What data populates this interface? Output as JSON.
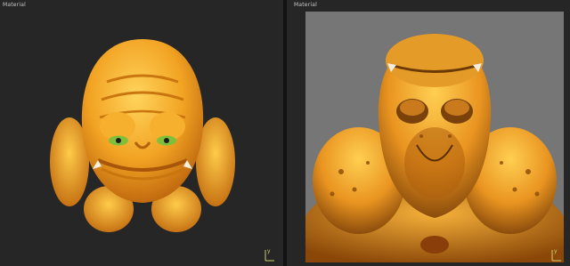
{
  "viewports": {
    "left": {
      "label": "Material"
    },
    "right": {
      "label": "Material"
    }
  },
  "axis_gizmo": {
    "vertical_label": "y"
  },
  "colors": {
    "viewport_bg": "#262626",
    "render_bg": "#767676",
    "model_orange": "#f0a020",
    "model_shadow": "#b35a0a",
    "eye_green": "#7fbf3a"
  }
}
